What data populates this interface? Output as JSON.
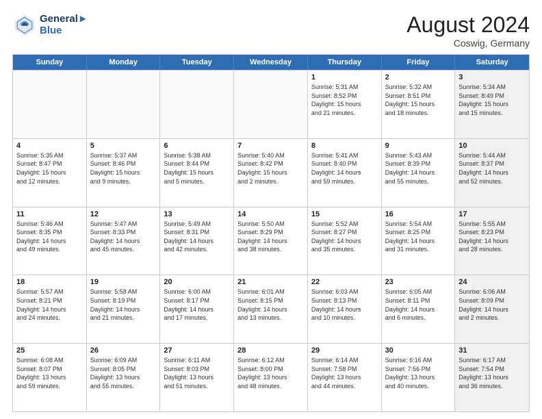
{
  "header": {
    "logo_line1": "General",
    "logo_line2": "Blue",
    "month": "August 2024",
    "location": "Coswig, Germany"
  },
  "weekdays": [
    "Sunday",
    "Monday",
    "Tuesday",
    "Wednesday",
    "Thursday",
    "Friday",
    "Saturday"
  ],
  "rows": [
    [
      {
        "day": "",
        "info": "",
        "empty": true
      },
      {
        "day": "",
        "info": "",
        "empty": true
      },
      {
        "day": "",
        "info": "",
        "empty": true
      },
      {
        "day": "",
        "info": "",
        "empty": true
      },
      {
        "day": "1",
        "info": "Sunrise: 5:31 AM\nSunset: 8:52 PM\nDaylight: 15 hours\nand 21 minutes."
      },
      {
        "day": "2",
        "info": "Sunrise: 5:32 AM\nSunset: 8:51 PM\nDaylight: 15 hours\nand 18 minutes."
      },
      {
        "day": "3",
        "info": "Sunrise: 5:34 AM\nSunset: 8:49 PM\nDaylight: 15 hours\nand 15 minutes.",
        "shaded": true
      }
    ],
    [
      {
        "day": "4",
        "info": "Sunrise: 5:35 AM\nSunset: 8:47 PM\nDaylight: 15 hours\nand 12 minutes."
      },
      {
        "day": "5",
        "info": "Sunrise: 5:37 AM\nSunset: 8:46 PM\nDaylight: 15 hours\nand 9 minutes."
      },
      {
        "day": "6",
        "info": "Sunrise: 5:38 AM\nSunset: 8:44 PM\nDaylight: 15 hours\nand 5 minutes."
      },
      {
        "day": "7",
        "info": "Sunrise: 5:40 AM\nSunset: 8:42 PM\nDaylight: 15 hours\nand 2 minutes."
      },
      {
        "day": "8",
        "info": "Sunrise: 5:41 AM\nSunset: 8:40 PM\nDaylight: 14 hours\nand 59 minutes."
      },
      {
        "day": "9",
        "info": "Sunrise: 5:43 AM\nSunset: 8:39 PM\nDaylight: 14 hours\nand 55 minutes."
      },
      {
        "day": "10",
        "info": "Sunrise: 5:44 AM\nSunset: 8:37 PM\nDaylight: 14 hours\nand 52 minutes.",
        "shaded": true
      }
    ],
    [
      {
        "day": "11",
        "info": "Sunrise: 5:46 AM\nSunset: 8:35 PM\nDaylight: 14 hours\nand 49 minutes."
      },
      {
        "day": "12",
        "info": "Sunrise: 5:47 AM\nSunset: 8:33 PM\nDaylight: 14 hours\nand 45 minutes."
      },
      {
        "day": "13",
        "info": "Sunrise: 5:49 AM\nSunset: 8:31 PM\nDaylight: 14 hours\nand 42 minutes."
      },
      {
        "day": "14",
        "info": "Sunrise: 5:50 AM\nSunset: 8:29 PM\nDaylight: 14 hours\nand 38 minutes."
      },
      {
        "day": "15",
        "info": "Sunrise: 5:52 AM\nSunset: 8:27 PM\nDaylight: 14 hours\nand 35 minutes."
      },
      {
        "day": "16",
        "info": "Sunrise: 5:54 AM\nSunset: 8:25 PM\nDaylight: 14 hours\nand 31 minutes."
      },
      {
        "day": "17",
        "info": "Sunrise: 5:55 AM\nSunset: 8:23 PM\nDaylight: 14 hours\nand 28 minutes.",
        "shaded": true
      }
    ],
    [
      {
        "day": "18",
        "info": "Sunrise: 5:57 AM\nSunset: 8:21 PM\nDaylight: 14 hours\nand 24 minutes."
      },
      {
        "day": "19",
        "info": "Sunrise: 5:58 AM\nSunset: 8:19 PM\nDaylight: 14 hours\nand 21 minutes."
      },
      {
        "day": "20",
        "info": "Sunrise: 6:00 AM\nSunset: 8:17 PM\nDaylight: 14 hours\nand 17 minutes."
      },
      {
        "day": "21",
        "info": "Sunrise: 6:01 AM\nSunset: 8:15 PM\nDaylight: 14 hours\nand 13 minutes."
      },
      {
        "day": "22",
        "info": "Sunrise: 6:03 AM\nSunset: 8:13 PM\nDaylight: 14 hours\nand 10 minutes."
      },
      {
        "day": "23",
        "info": "Sunrise: 6:05 AM\nSunset: 8:11 PM\nDaylight: 14 hours\nand 6 minutes."
      },
      {
        "day": "24",
        "info": "Sunrise: 6:06 AM\nSunset: 8:09 PM\nDaylight: 14 hours\nand 2 minutes.",
        "shaded": true
      }
    ],
    [
      {
        "day": "25",
        "info": "Sunrise: 6:08 AM\nSunset: 8:07 PM\nDaylight: 13 hours\nand 59 minutes."
      },
      {
        "day": "26",
        "info": "Sunrise: 6:09 AM\nSunset: 8:05 PM\nDaylight: 13 hours\nand 55 minutes."
      },
      {
        "day": "27",
        "info": "Sunrise: 6:11 AM\nSunset: 8:03 PM\nDaylight: 13 hours\nand 51 minutes."
      },
      {
        "day": "28",
        "info": "Sunrise: 6:12 AM\nSunset: 8:00 PM\nDaylight: 13 hours\nand 48 minutes."
      },
      {
        "day": "29",
        "info": "Sunrise: 6:14 AM\nSunset: 7:58 PM\nDaylight: 13 hours\nand 44 minutes."
      },
      {
        "day": "30",
        "info": "Sunrise: 6:16 AM\nSunset: 7:56 PM\nDaylight: 13 hours\nand 40 minutes."
      },
      {
        "day": "31",
        "info": "Sunrise: 6:17 AM\nSunset: 7:54 PM\nDaylight: 13 hours\nand 36 minutes.",
        "shaded": true
      }
    ]
  ]
}
